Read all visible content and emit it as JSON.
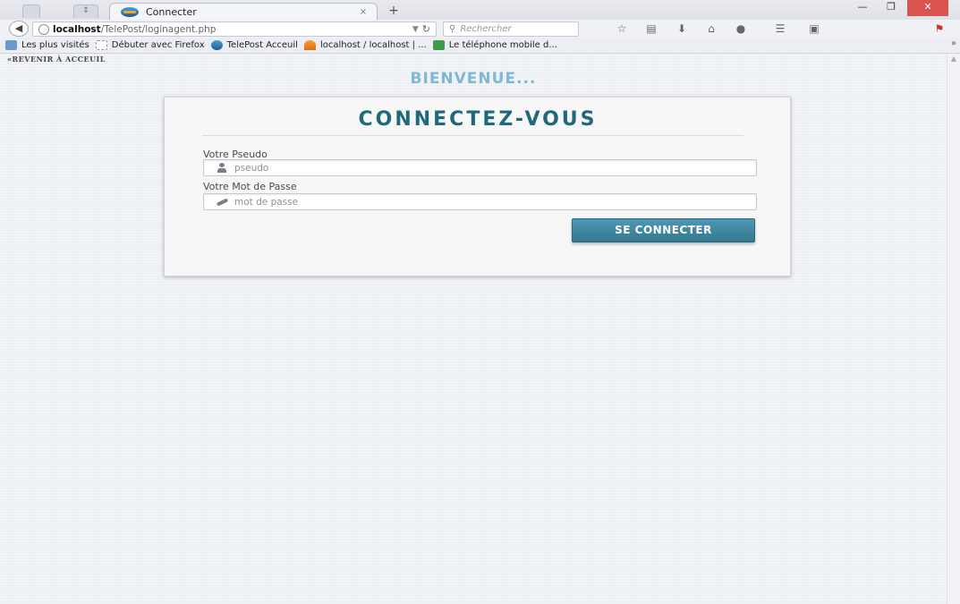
{
  "browser": {
    "tab_title": "Connecter",
    "tab_close": "×",
    "new_tab": "+",
    "url_host": "localhost",
    "url_path": "/TelePost/loginagent.php",
    "search_placeholder": "Rechercher",
    "bookmarks": [
      "Les plus visités",
      "Débuter avec Firefox",
      "TelePost Acceuil",
      "localhost / localhost | ...",
      "Le téléphone mobile d..."
    ],
    "bookmarks_overflow": "»"
  },
  "page": {
    "back_link": "«REVENIR À ACCEUIL",
    "welcome": "BIENVENUE...",
    "login": {
      "title": "Connectez-vous",
      "username_label": "Votre Pseudo",
      "username_placeholder": "pseudo",
      "username_value": "",
      "password_label": "Votre Mot de Passe",
      "password_placeholder": "mot de passe",
      "password_value": "",
      "submit_label": "SE CONNECTER"
    }
  },
  "colors": {
    "accent": "#3a84a0",
    "title": "#1e6a7a",
    "welcome": "#7fb8d3",
    "close_button": "#d9534f"
  }
}
